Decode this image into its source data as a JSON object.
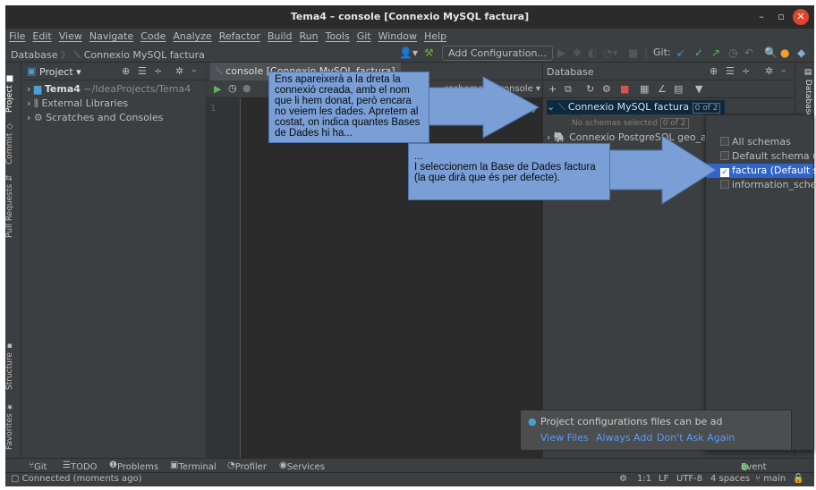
{
  "window": {
    "title": "Tema4 – console [Connexio MySQL factura]",
    "minimize": "–",
    "maximize": "▫",
    "close": "✕"
  },
  "menu": [
    "File",
    "Edit",
    "View",
    "Navigate",
    "Code",
    "Analyze",
    "Refactor",
    "Build",
    "Run",
    "Tools",
    "Git",
    "Window",
    "Help"
  ],
  "nav": {
    "breadcrumb_root": "Database",
    "breadcrumb_sep": "〉",
    "breadcrumb_item": "Connexio MySQL factura",
    "config_button": "Add Configuration...",
    "git_label": "Git:"
  },
  "left_strip": {
    "project": "Project",
    "commit": "Commit",
    "pull_requests": "Pull Requests",
    "structure": "Structure",
    "favorites": "Favorites"
  },
  "project_panel": {
    "title": "Project",
    "tree": [
      {
        "label": "Tema4",
        "suffix": "~/IdeaProjects/Tema4"
      },
      {
        "label": "External Libraries"
      },
      {
        "label": "Scratches and Consoles"
      }
    ]
  },
  "editor": {
    "tab_label": "console [Connexio MySQL factura]",
    "schema_selector": "<schema>",
    "console_selector": "console",
    "line_number": "1"
  },
  "database_panel": {
    "title": "Database",
    "tree": [
      {
        "label": "Connexio MySQL factura",
        "badge": "0 of 2"
      },
      {
        "label": "No schemas selected",
        "badge": "0 of 2"
      },
      {
        "label": "Connexio PostgreSQL geo_ad"
      }
    ]
  },
  "schema_dropdown": {
    "items": [
      {
        "label": "All schemas",
        "checked": false
      },
      {
        "label": "Default schema (",
        "checked": false
      },
      {
        "label": "factura  (Default s",
        "checked": true
      },
      {
        "label": "information_sche",
        "checked": false
      }
    ]
  },
  "right_strip": {
    "database": "Database"
  },
  "notification": {
    "text": "Project configurations files can be ad",
    "actions": [
      "View Files",
      "Always Add",
      "Don't Ask Again"
    ]
  },
  "bottom_tools": [
    "Git",
    "TODO",
    "Problems",
    "Terminal",
    "Profiler",
    "Services"
  ],
  "event_log": "Event Log",
  "status": {
    "message": "Connected (moments ago)",
    "position": "1:1",
    "line_sep": "LF",
    "encoding": "UTF-8",
    "indent": "4 spaces",
    "branch": "main"
  },
  "callouts": {
    "first": "Ens apareixerà a la dreta la connexió creada, amb el nom que li hem donat, però encara no veiem les dades. Apretem al costat, on indica quantes Bases de Dades hi ha...",
    "second_lead": "...",
    "second": "I seleccionem la Base de Dades factura (la que dirà que és per defecte)."
  },
  "colors": {
    "ide_bg": "#3c3f41",
    "editor_bg": "#2b2b2b",
    "callout_bg": "#7a9fd6",
    "selection": "#2f65ca",
    "link": "#589df6"
  }
}
